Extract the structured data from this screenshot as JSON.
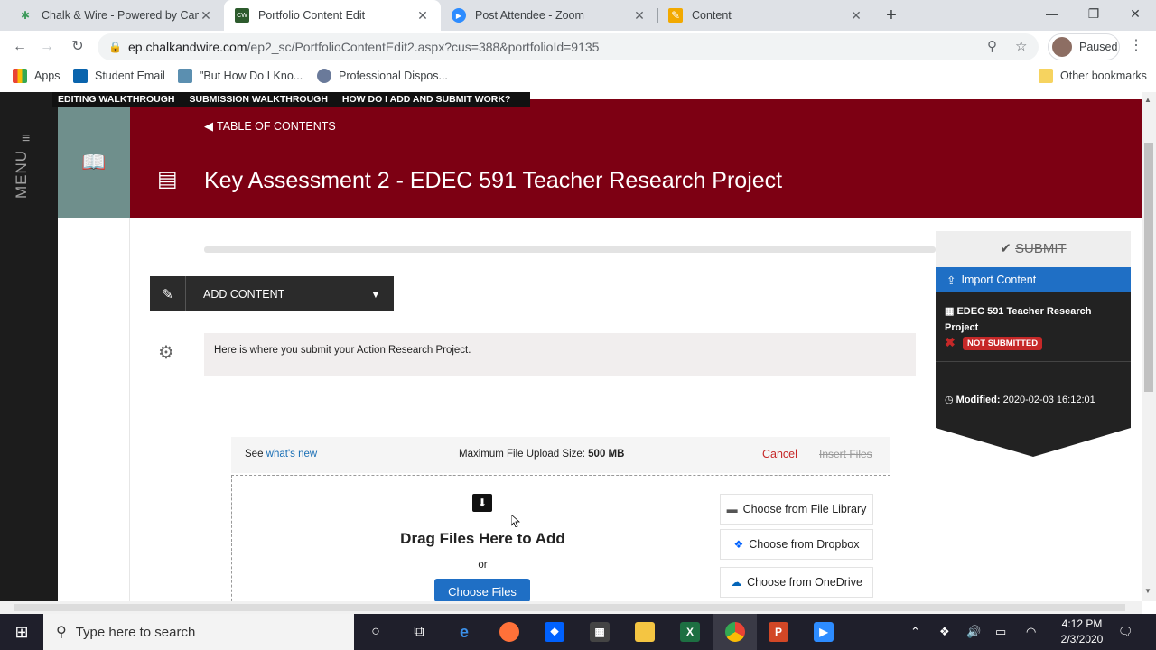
{
  "browser": {
    "tabs": [
      {
        "title": "Chalk & Wire - Powered by Cam",
        "icon": "chalkwire-icon"
      },
      {
        "title": "Portfolio Content Edit",
        "icon": "cw-icon",
        "active": true
      },
      {
        "title": "Post Attendee - Zoom",
        "icon": "zoom-icon"
      },
      {
        "title": "Content",
        "icon": "pencil-icon"
      }
    ],
    "url_host": "ep.chalkandwire.com",
    "url_path": "/ep2_sc/PortfolioContentEdit2.aspx?cus=388&portfolioId=9135",
    "profile_label": "Paused",
    "bookmarks": [
      "Apps",
      "Student Email",
      "\"But How Do I Kno...",
      "Professional Dispos..."
    ],
    "other_bookmarks": "Other bookmarks"
  },
  "site": {
    "menu_label": "MENU",
    "help_links": [
      "EDITING WALKTHROUGH",
      "SUBMISSION WALKTHROUGH",
      "HOW DO I ADD AND SUBMIT WORK?"
    ],
    "toc_label": "TABLE OF CONTENTS",
    "page_title": "Key Assessment 2 - EDEC 591 Teacher Research Project",
    "add_content_label": "ADD CONTENT",
    "description": "Here is where you submit your Action Research Project.",
    "upload": {
      "see_text": "See ",
      "whats_new": "what's new",
      "max_size_label": "Maximum File Upload Size: ",
      "max_size_value": "500 MB",
      "cancel": "Cancel",
      "insert": "Insert Files",
      "drag_title": "Drag Files Here to Add",
      "or": "or",
      "choose_files": "Choose Files",
      "sources": [
        "Choose from File Library",
        "Choose from Dropbox",
        "Choose from OneDrive"
      ]
    },
    "sidebar": {
      "submit": "SUBMIT",
      "import": "Import Content",
      "project_name": "EDEC 591 Teacher Research Project",
      "status": "NOT SUBMITTED",
      "modified_label": "Modified:",
      "modified_value": "2020-02-03 16:12:01"
    }
  },
  "taskbar": {
    "search_placeholder": "Type here to search",
    "time": "4:12 PM",
    "date": "2/3/2020"
  },
  "colors": {
    "header": "#7d0013",
    "accent_blue": "#1f6fc5",
    "danger": "#c62828"
  }
}
